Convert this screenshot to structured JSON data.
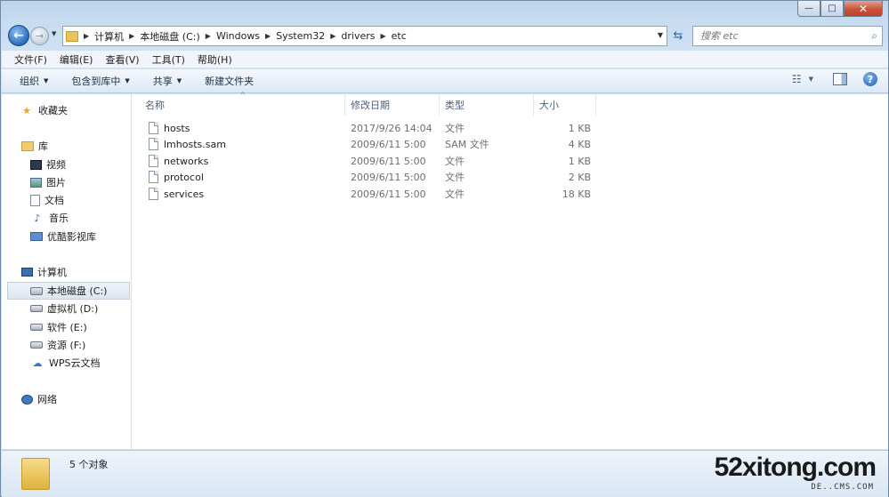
{
  "window": {
    "minimize_label": "—",
    "maximize_label": "□",
    "close_label": "✕"
  },
  "address": {
    "breadcrumbs": [
      "计算机",
      "本地磁盘 (C:)",
      "Windows",
      "System32",
      "drivers",
      "etc"
    ],
    "search_placeholder": "搜索 etc"
  },
  "menu": [
    "文件(F)",
    "编辑(E)",
    "查看(V)",
    "工具(T)",
    "帮助(H)"
  ],
  "toolbar": {
    "organize": "组织",
    "include_in_library": "包含到库中",
    "share": "共享",
    "new_folder": "新建文件夹"
  },
  "nav": {
    "favorites": "收藏夹",
    "libraries": "库",
    "videos": "视频",
    "pictures": "图片",
    "documents": "文档",
    "music": "音乐",
    "youku": "优酷影视库",
    "computer": "计算机",
    "drive_c": "本地磁盘 (C:)",
    "drive_d": "虚拟机 (D:)",
    "drive_e": "软件 (E:)",
    "drive_f": "资源 (F:)",
    "wps_cloud": "WPS云文档",
    "network": "网络"
  },
  "columns": {
    "name": "名称",
    "date": "修改日期",
    "type": "类型",
    "size": "大小"
  },
  "files": [
    {
      "name": "hosts",
      "date": "2017/9/26 14:04",
      "type": "文件",
      "size": "1 KB"
    },
    {
      "name": "lmhosts.sam",
      "date": "2009/6/11 5:00",
      "type": "SAM 文件",
      "size": "4 KB"
    },
    {
      "name": "networks",
      "date": "2009/6/11 5:00",
      "type": "文件",
      "size": "1 KB"
    },
    {
      "name": "protocol",
      "date": "2009/6/11 5:00",
      "type": "文件",
      "size": "2 KB"
    },
    {
      "name": "services",
      "date": "2009/6/11 5:00",
      "type": "文件",
      "size": "18 KB"
    }
  ],
  "status": {
    "item_count": "5 个对象"
  },
  "watermark": {
    "main": "52xitong.com",
    "sub": "DE..CMS.COM"
  },
  "colors": {
    "frame": "#c9dcef",
    "accent": "#2b6bc1",
    "close": "#c8523b"
  }
}
